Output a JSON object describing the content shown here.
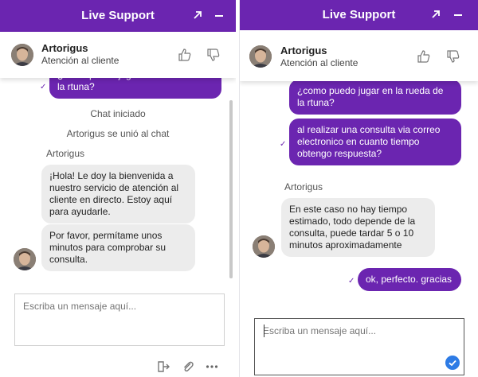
{
  "left": {
    "header": {
      "title": "Live Support",
      "popout_icon": "popout-arrow-icon",
      "minimize_icon": "minimize-icon"
    },
    "agent": {
      "name": "Artorigus",
      "role": "Atención al cliente"
    },
    "messages": {
      "partial_user": "¿como puedo jugar en la rueda de la rtuna?",
      "chat_started": "Chat iniciado",
      "agent_joined": "Artorigus se unió al chat",
      "sender": "Artorigus",
      "agent_msg_1": "¡Hola! Le doy la bienvenida a nuestro servicio de atención al cliente en directo. Estoy aquí para ayudarle.",
      "agent_msg_2": "Por favor, permítame unos minutos para comprobar su consulta."
    },
    "input": {
      "placeholder": "Escriba un mensaje aquí..."
    },
    "footer": {
      "icons": [
        "end-chat-icon",
        "attach-icon",
        "more-icon"
      ]
    }
  },
  "right": {
    "header": {
      "title": "Live Support",
      "popout_icon": "popout-arrow-icon",
      "minimize_icon": "minimize-icon"
    },
    "agent": {
      "name": "Artorigus",
      "role": "Atención al cliente"
    },
    "messages": {
      "user_msg_1": "¿como puedo jugar en la rueda de la rtuna?",
      "user_msg_2": "al realizar una consulta via correo electronico en cuanto tiempo obtengo respuesta?",
      "sender": "Artorigus",
      "agent_msg": "En este caso no hay tiempo estimado, todo depende de la consulta, puede tardar 5 o 10 minutos aproximadamente",
      "user_msg_3": "ok, perfecto. gracias"
    },
    "input": {
      "placeholder": "Escriba un mensaje aquí..."
    }
  },
  "colors": {
    "brand": "#6b25b0",
    "agent_bubble": "#ececec",
    "send": "#2d7be5"
  }
}
